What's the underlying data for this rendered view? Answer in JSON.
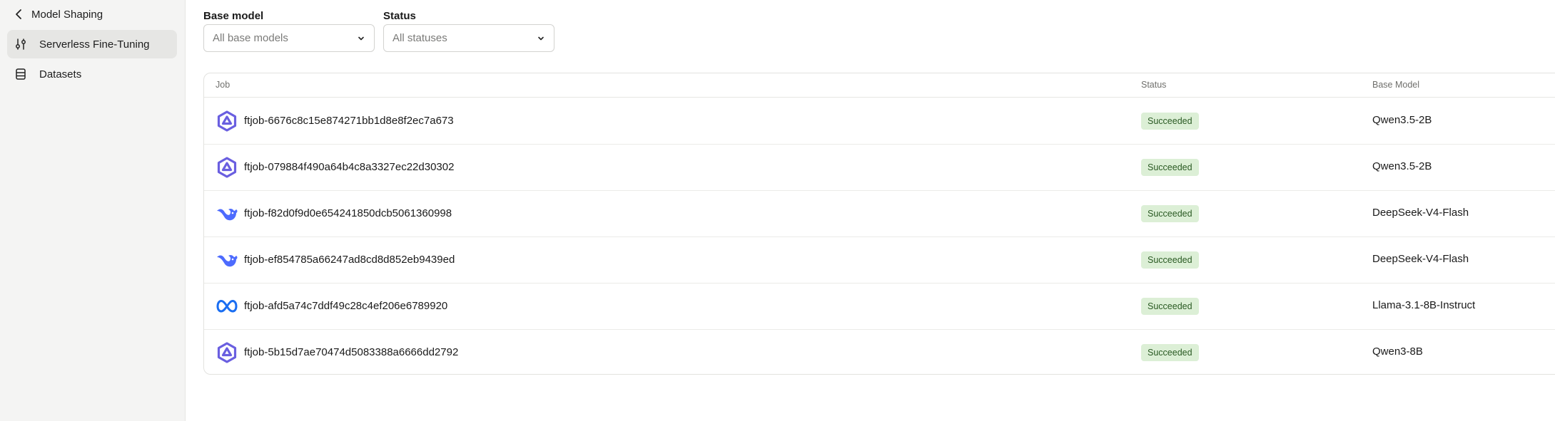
{
  "sidebar": {
    "back_label": "Model Shaping",
    "items": [
      {
        "label": "Serverless Fine-Tuning",
        "icon": "sliders-icon",
        "active": true
      },
      {
        "label": "Datasets",
        "icon": "database-icon",
        "active": false
      }
    ]
  },
  "filters": {
    "base_model": {
      "label": "Base model",
      "placeholder": "All base models"
    },
    "status": {
      "label": "Status",
      "placeholder": "All statuses"
    }
  },
  "table": {
    "columns": {
      "job": "Job",
      "status": "Status",
      "base_model": "Base Model"
    },
    "rows": [
      {
        "job": "ftjob-6676c8c15e874271bb1d8e8f2ec7a673",
        "status": "Succeeded",
        "base_model": "Qwen3.5-2B",
        "icon": "qwen-icon"
      },
      {
        "job": "ftjob-079884f490a64b4c8a3327ec22d30302",
        "status": "Succeeded",
        "base_model": "Qwen3.5-2B",
        "icon": "qwen-icon"
      },
      {
        "job": "ftjob-f82d0f9d0e654241850dcb5061360998",
        "status": "Succeeded",
        "base_model": "DeepSeek-V4-Flash",
        "icon": "deepseek-icon"
      },
      {
        "job": "ftjob-ef854785a66247ad8cd8d852eb9439ed",
        "status": "Succeeded",
        "base_model": "DeepSeek-V4-Flash",
        "icon": "deepseek-icon"
      },
      {
        "job": "ftjob-afd5a74c7ddf49c28c4ef206e6789920",
        "status": "Succeeded",
        "base_model": "Llama-3.1-8B-Instruct",
        "icon": "meta-icon"
      },
      {
        "job": "ftjob-5b15d7ae70474d5083388a6666dd2792",
        "status": "Succeeded",
        "base_model": "Qwen3-8B",
        "icon": "qwen-icon"
      }
    ]
  },
  "colors": {
    "qwen": "#6a5fe0",
    "deepseek": "#4d6bfe",
    "meta": "#1a6ef2",
    "status_succeeded_bg": "#dcefd6",
    "status_succeeded_text": "#2a5a23"
  }
}
